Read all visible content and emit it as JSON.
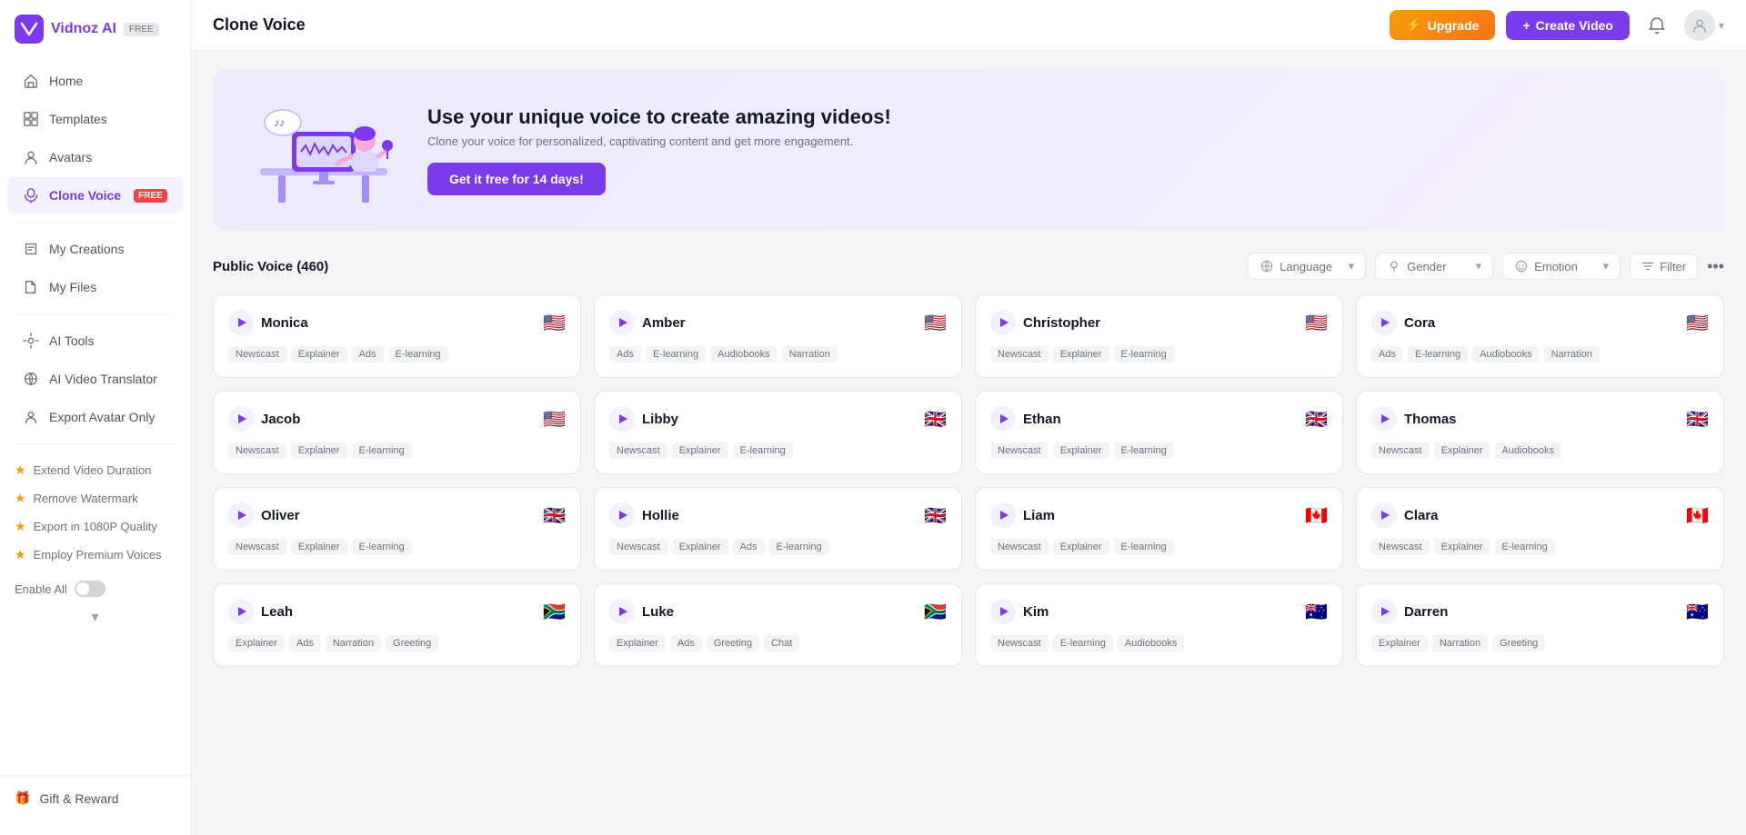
{
  "logo": {
    "text": "Vidnoz AI",
    "badge": "FREE"
  },
  "header": {
    "title": "Clone Voice",
    "upgrade_label": "Upgrade",
    "create_label": "Create Video"
  },
  "sidebar": {
    "items": [
      {
        "id": "home",
        "label": "Home",
        "active": false
      },
      {
        "id": "templates",
        "label": "Templates",
        "active": false
      },
      {
        "id": "avatars",
        "label": "Avatars",
        "active": false
      },
      {
        "id": "clone-voice",
        "label": "Clone Voice",
        "active": true,
        "badge": "FREE"
      },
      {
        "id": "my-creations",
        "label": "My Creations",
        "active": false
      },
      {
        "id": "my-files",
        "label": "My Files",
        "active": false
      }
    ],
    "tools": [
      {
        "id": "ai-tools",
        "label": "AI Tools"
      },
      {
        "id": "ai-video-translator",
        "label": "AI Video Translator"
      },
      {
        "id": "export-avatar-only",
        "label": "Export Avatar Only"
      }
    ],
    "premium": [
      {
        "label": "Extend Video Duration"
      },
      {
        "label": "Remove Watermark"
      },
      {
        "label": "Export in 1080P Quality"
      },
      {
        "label": "Employ Premium Voices"
      }
    ],
    "enable_all": "Enable All",
    "gift_label": "Gift & Reward"
  },
  "banner": {
    "title": "Use your unique voice to create amazing videos!",
    "subtitle": "Clone your voice for personalized, captivating content and get more engagement.",
    "cta": "Get it free for 14 days!"
  },
  "filter_bar": {
    "voice_count_label": "Public Voice (460)",
    "language_label": "Language",
    "gender_label": "Gender",
    "emotion_label": "Emotion",
    "filter_label": "Filter"
  },
  "voices": [
    {
      "name": "Monica",
      "flag": "🇺🇸",
      "tags": [
        "Newscast",
        "Explainer",
        "Ads",
        "E-learning"
      ]
    },
    {
      "name": "Amber",
      "flag": "🇺🇸",
      "tags": [
        "Ads",
        "E-learning",
        "Audiobooks",
        "Narration"
      ]
    },
    {
      "name": "Christopher",
      "flag": "🇺🇸",
      "tags": [
        "Newscast",
        "Explainer",
        "E-learning"
      ]
    },
    {
      "name": "Cora",
      "flag": "🇺🇸",
      "tags": [
        "Ads",
        "E-learning",
        "Audiobooks",
        "Narration"
      ]
    },
    {
      "name": "Jacob",
      "flag": "🇺🇸",
      "tags": [
        "Newscast",
        "Explainer",
        "E-learning"
      ]
    },
    {
      "name": "Libby",
      "flag": "🇬🇧",
      "tags": [
        "Newscast",
        "Explainer",
        "E-learning"
      ]
    },
    {
      "name": "Ethan",
      "flag": "🇬🇧",
      "tags": [
        "Newscast",
        "Explainer",
        "E-learning"
      ]
    },
    {
      "name": "Thomas",
      "flag": "🇬🇧",
      "tags": [
        "Newscast",
        "Explainer",
        "Audiobooks"
      ]
    },
    {
      "name": "Oliver",
      "flag": "🇬🇧",
      "tags": [
        "Newscast",
        "Explainer",
        "E-learning"
      ]
    },
    {
      "name": "Hollie",
      "flag": "🇬🇧",
      "tags": [
        "Newscast",
        "Explainer",
        "Ads",
        "E-learning"
      ]
    },
    {
      "name": "Liam",
      "flag": "🇨🇦",
      "tags": [
        "Newscast",
        "Explainer",
        "E-learning"
      ]
    },
    {
      "name": "Clara",
      "flag": "🇨🇦",
      "tags": [
        "Newscast",
        "Explainer",
        "E-learning"
      ]
    },
    {
      "name": "Leah",
      "flag": "🇿🇦",
      "tags": [
        "Explainer",
        "Ads",
        "Narration",
        "Greeting"
      ]
    },
    {
      "name": "Luke",
      "flag": "🇿🇦",
      "tags": [
        "Explainer",
        "Ads",
        "Greeting",
        "Chat"
      ]
    },
    {
      "name": "Kim",
      "flag": "🇦🇺",
      "tags": [
        "Newscast",
        "E-learning",
        "Audiobooks"
      ]
    },
    {
      "name": "Darren",
      "flag": "🇦🇺",
      "tags": [
        "Explainer",
        "Narration",
        "Greeting"
      ]
    }
  ]
}
